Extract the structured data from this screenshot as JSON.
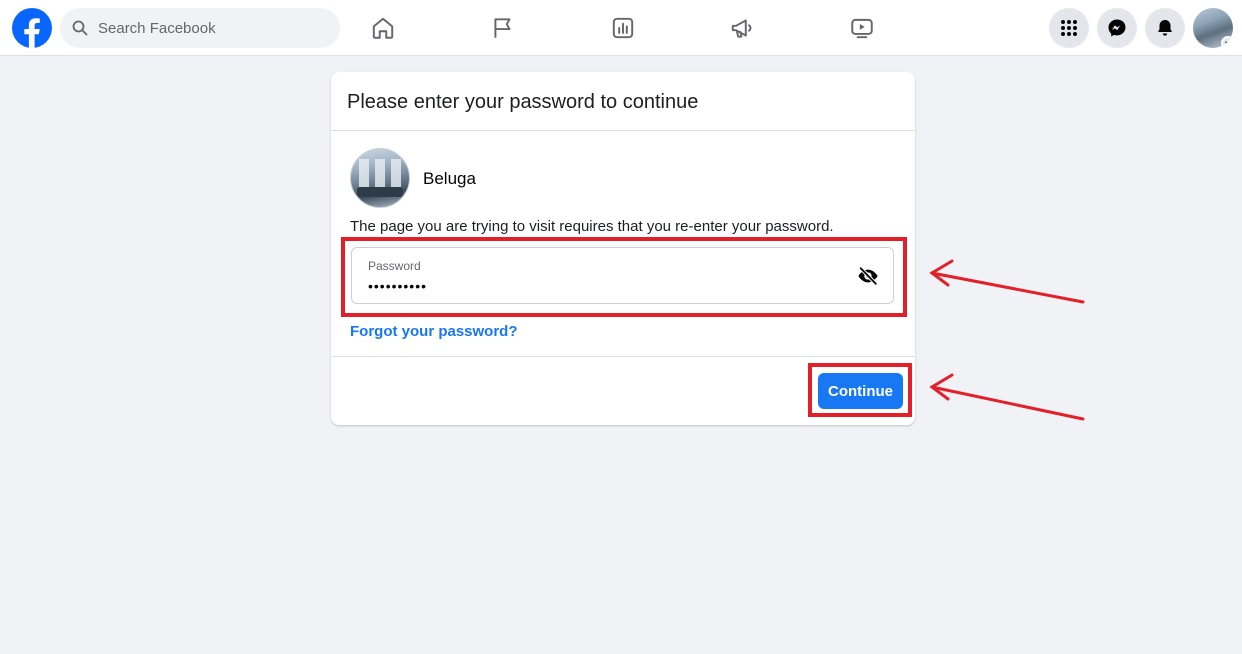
{
  "header": {
    "search_placeholder": "Search Facebook",
    "nav": [
      "home-icon",
      "flag-icon",
      "chart-icon",
      "megaphone-icon",
      "video-icon"
    ],
    "right_buttons": [
      "menu-grid-icon",
      "messenger-icon",
      "bell-icon",
      "profile-avatar"
    ]
  },
  "dialog": {
    "title": "Please enter your password to continue",
    "profile_name": "Beluga",
    "message": "The page you are trying to visit requires that you re-enter your password.",
    "password_label": "Password",
    "password_value": "••••••••••",
    "forgot_link": "Forgot your password?",
    "continue_label": "Continue"
  },
  "colors": {
    "brand": "#1877f2",
    "annotation": "#e3202a",
    "background": "#f0f2f5"
  }
}
